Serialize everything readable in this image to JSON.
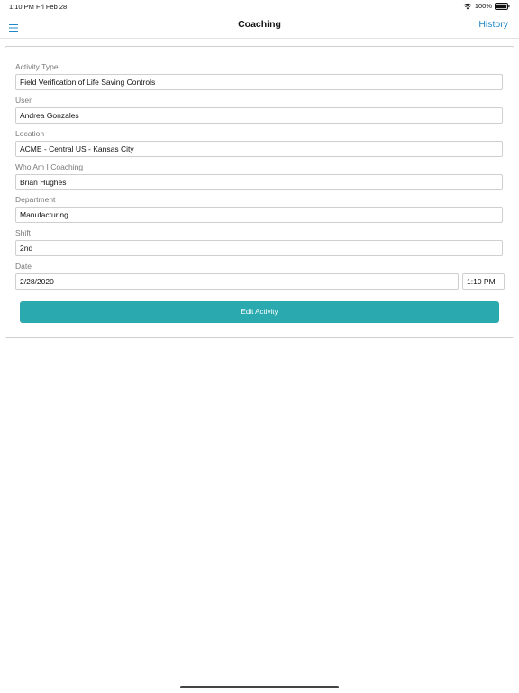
{
  "status_bar": {
    "time": "1:10 PM",
    "date": "Fri Feb 28",
    "battery": "100%"
  },
  "nav": {
    "menu_icon": "hamburger-menu-icon",
    "title": "Coaching",
    "history_label": "History",
    "accent_color": "#1f88c9"
  },
  "form": {
    "activity_type": {
      "label": "Activity Type",
      "value": "Field Verification of Life Saving Controls"
    },
    "user": {
      "label": "User",
      "value": "Andrea Gonzales"
    },
    "location": {
      "label": "Location",
      "value": "ACME - Central US -  Kansas City"
    },
    "coaching": {
      "label": "Who Am I Coaching",
      "value": "Brian Hughes"
    },
    "department": {
      "label": "Department",
      "value": "Manufacturing"
    },
    "shift": {
      "label": "Shift",
      "value": "2nd"
    },
    "date": {
      "label": "Date",
      "date_value": "2/28/2020",
      "time_value": "1:10 PM"
    },
    "edit_button_label": "Edit Activity",
    "button_color": "#2aa9ae"
  }
}
